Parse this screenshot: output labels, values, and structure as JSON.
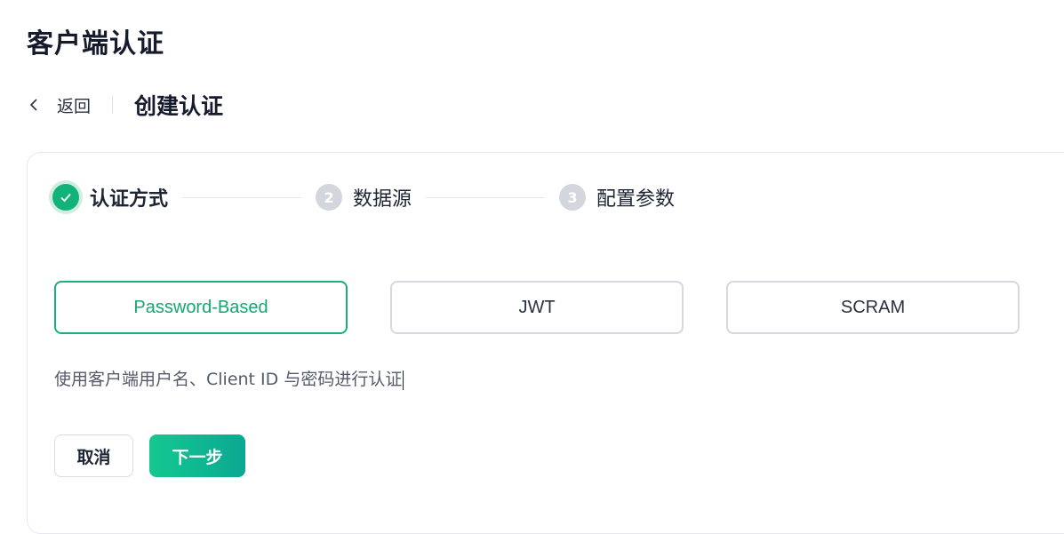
{
  "page": {
    "title": "客户端认证"
  },
  "header": {
    "back_label": "返回",
    "sub_title": "创建认证",
    "back_icon": "chevron-left-icon"
  },
  "steps": [
    {
      "number": "1",
      "label": "认证方式",
      "status": "done"
    },
    {
      "number": "2",
      "label": "数据源",
      "status": "pending"
    },
    {
      "number": "3",
      "label": "配置参数",
      "status": "pending"
    }
  ],
  "auth_options": [
    {
      "label": "Password-Based",
      "selected": true
    },
    {
      "label": "JWT",
      "selected": false
    },
    {
      "label": "SCRAM",
      "selected": false
    }
  ],
  "description": "使用客户端用户名、Client ID 与密码进行认证",
  "actions": {
    "cancel_label": "取消",
    "next_label": "下一步"
  },
  "colors": {
    "accent": "#13b27a",
    "step_pending": "#d3d6dd",
    "border": "#d5d8e0"
  }
}
